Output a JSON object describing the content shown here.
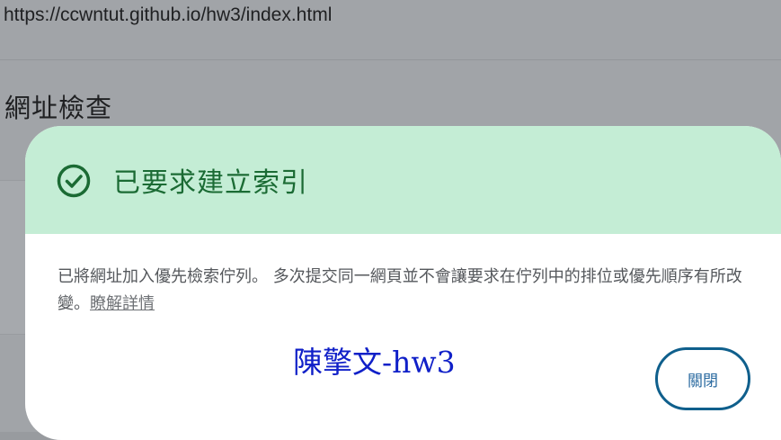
{
  "background": {
    "url": "https://ccwntut.github.io/hw3/index.html",
    "heading": "網址檢查"
  },
  "dialog": {
    "title": "已要求建立索引",
    "title_icon": "check-circle-icon",
    "body": "已將網址加入優先檢索佇列。 多次提交同一網頁並不會讓要求在佇列中的排位或優先順序有所改變。",
    "learn_more_label": "瞭解詳情",
    "signature": "陳擎文-hw3",
    "close_label": "關閉"
  },
  "colors": {
    "overlay": "#a1a4a8",
    "header_bg": "#c4edd5",
    "title_color": "#1b6b34",
    "button_border": "#0f5f8c",
    "signature_color": "#1020c8"
  }
}
